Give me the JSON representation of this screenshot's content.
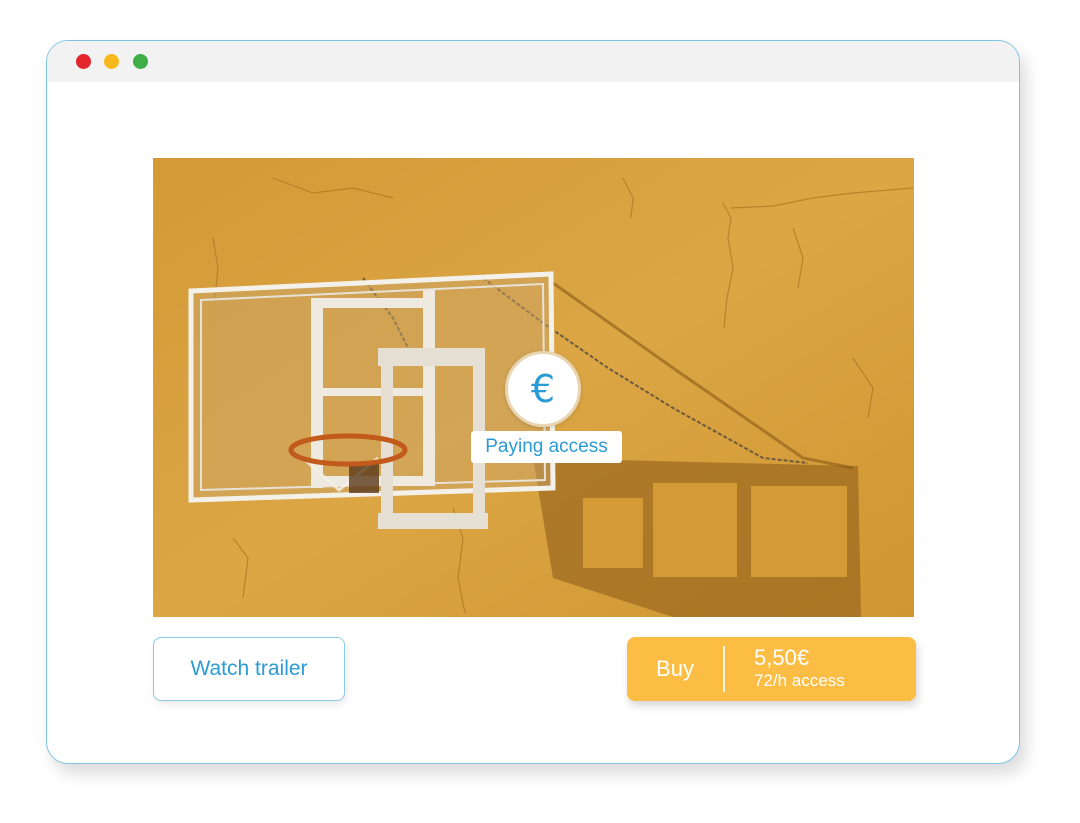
{
  "window": {
    "controls": [
      "close",
      "minimize",
      "maximize"
    ]
  },
  "media": {
    "image_description_icon": "basketball-hoop-image",
    "paywall": {
      "icon": "euro-icon",
      "symbol": "€",
      "label": "Paying access"
    }
  },
  "actions": {
    "trailer_label": "Watch trailer",
    "buy_label": "Buy",
    "price": "5,50€",
    "access": "72/h access"
  },
  "colors": {
    "accent_blue": "#2b9bd6",
    "buy_yellow": "#fbbd43",
    "window_border": "#7fc3e4",
    "wall": "#d9a33f"
  }
}
